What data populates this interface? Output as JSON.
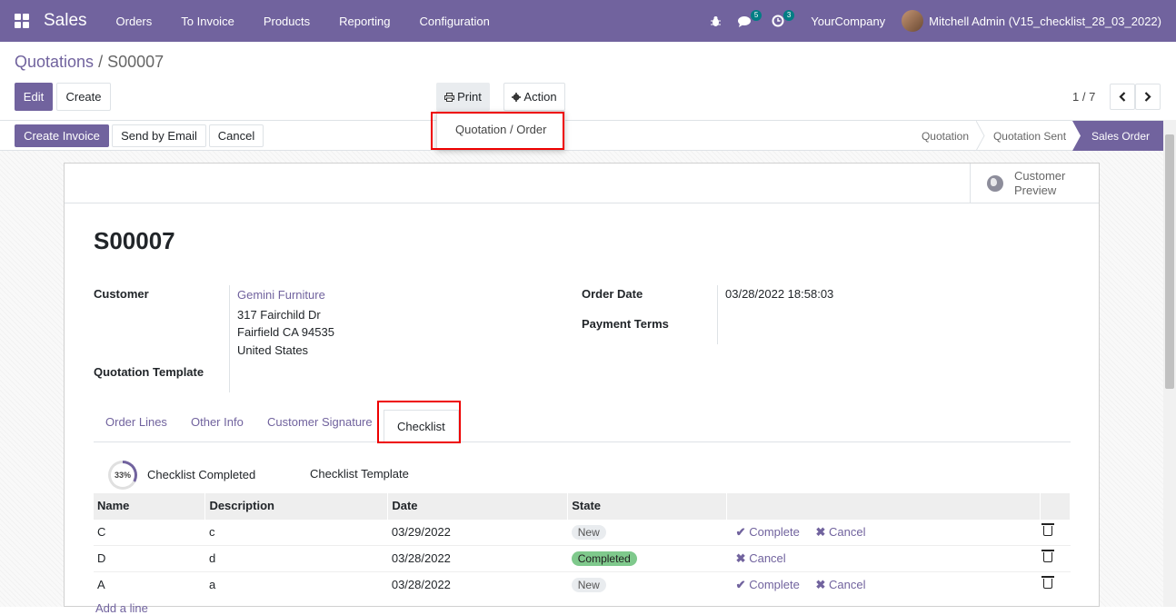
{
  "nav": {
    "app": "Sales",
    "menu": [
      "Orders",
      "To Invoice",
      "Products",
      "Reporting",
      "Configuration"
    ],
    "messages_count": "5",
    "activities_count": "3",
    "company": "YourCompany",
    "user": "Mitchell Admin (V15_checklist_28_03_2022)"
  },
  "breadcrumb": {
    "parent": "Quotations",
    "sep": " / ",
    "current": "S00007"
  },
  "toolbar": {
    "edit": "Edit",
    "create": "Create",
    "print": "Print",
    "action": "Action",
    "pager": "1 / 7",
    "print_menu": [
      "Quotation / Order"
    ]
  },
  "status_buttons": {
    "create_invoice": "Create Invoice",
    "send_email": "Send by Email",
    "cancel": "Cancel"
  },
  "stages": [
    "Quotation",
    "Quotation Sent",
    "Sales Order"
  ],
  "active_stage": "Sales Order",
  "sheet": {
    "preview_label": "Customer Preview",
    "title": "S00007",
    "customer_label": "Customer",
    "customer_name": "Gemini Furniture",
    "address": [
      "317 Fairchild Dr",
      "Fairfield CA 94535",
      "United States"
    ],
    "template_label": "Quotation Template",
    "order_date_label": "Order Date",
    "order_date": "03/28/2022 18:58:03",
    "payment_terms_label": "Payment Terms"
  },
  "tabs": [
    "Order Lines",
    "Other Info",
    "Customer Signature",
    "Checklist"
  ],
  "active_tab": "Checklist",
  "checklist": {
    "progress": "33%",
    "completed_label": "Checklist Completed",
    "template_label": "Checklist Template",
    "columns": [
      "Name",
      "Description",
      "Date",
      "State"
    ],
    "rows": [
      {
        "name": "C",
        "description": "c",
        "date": "03/29/2022",
        "state": "New",
        "actions": [
          "Complete",
          "Cancel"
        ]
      },
      {
        "name": "D",
        "description": "d",
        "date": "03/28/2022",
        "state": "Completed",
        "actions": [
          "Cancel"
        ]
      },
      {
        "name": "A",
        "description": "a",
        "date": "03/28/2022",
        "state": "New",
        "actions": [
          "Complete",
          "Cancel"
        ]
      }
    ],
    "add_line": "Add a line"
  }
}
